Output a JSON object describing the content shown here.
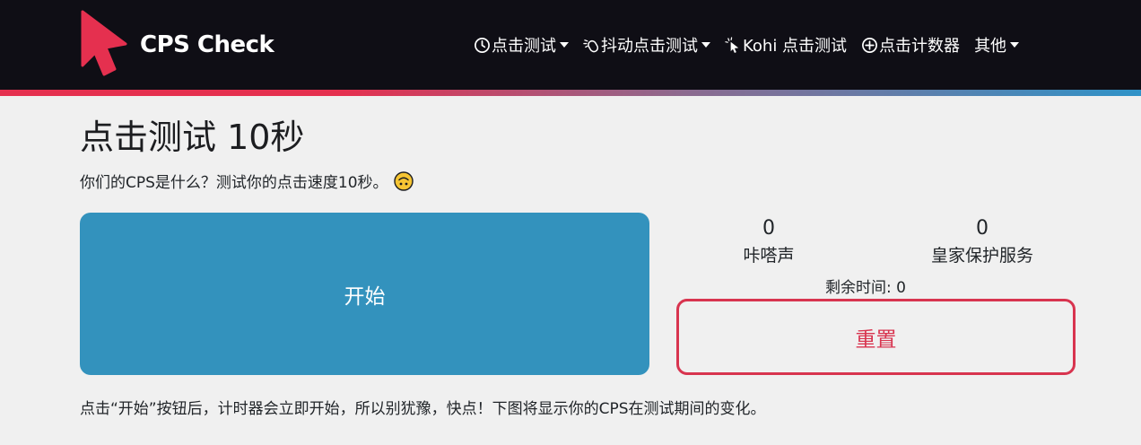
{
  "brand": {
    "name": "CPS Check",
    "logo_color": "#e5304f"
  },
  "nav": {
    "items": [
      {
        "label": "点击测试",
        "icon": "clock-icon",
        "dropdown": true
      },
      {
        "label": "抖动点击测试",
        "icon": "jitter-mouse-icon",
        "dropdown": true
      },
      {
        "label": "Kohi 点击测试",
        "icon": "cursor-click-icon",
        "dropdown": false
      },
      {
        "label": "点击计数器",
        "icon": "plus-circle-icon",
        "dropdown": false
      },
      {
        "label": "其他",
        "icon": "",
        "dropdown": true
      }
    ]
  },
  "main": {
    "title": "点击测试 10秒",
    "subtitle": "你们的CPS是什么？测试你的点击速度10秒。",
    "subtitle_emoji": "upside-down-face-icon",
    "start_label": "开始",
    "clicks_value": "0",
    "clicks_label": "咔嗒声",
    "cps_value": "0",
    "cps_label": "皇家保护服务",
    "timer_label": "剩余时间: 0",
    "reset_label": "重置",
    "footer": "点击“开始”按钮后，计时器会立即开始，所以别犹豫，快点！下图将显示你的CPS在测试期间的变化。"
  },
  "colors": {
    "navbar_bg": "#0f0e15",
    "accent_red": "#d8344f",
    "accent_blue": "#3392bd",
    "page_bg": "#f0f0f0"
  }
}
